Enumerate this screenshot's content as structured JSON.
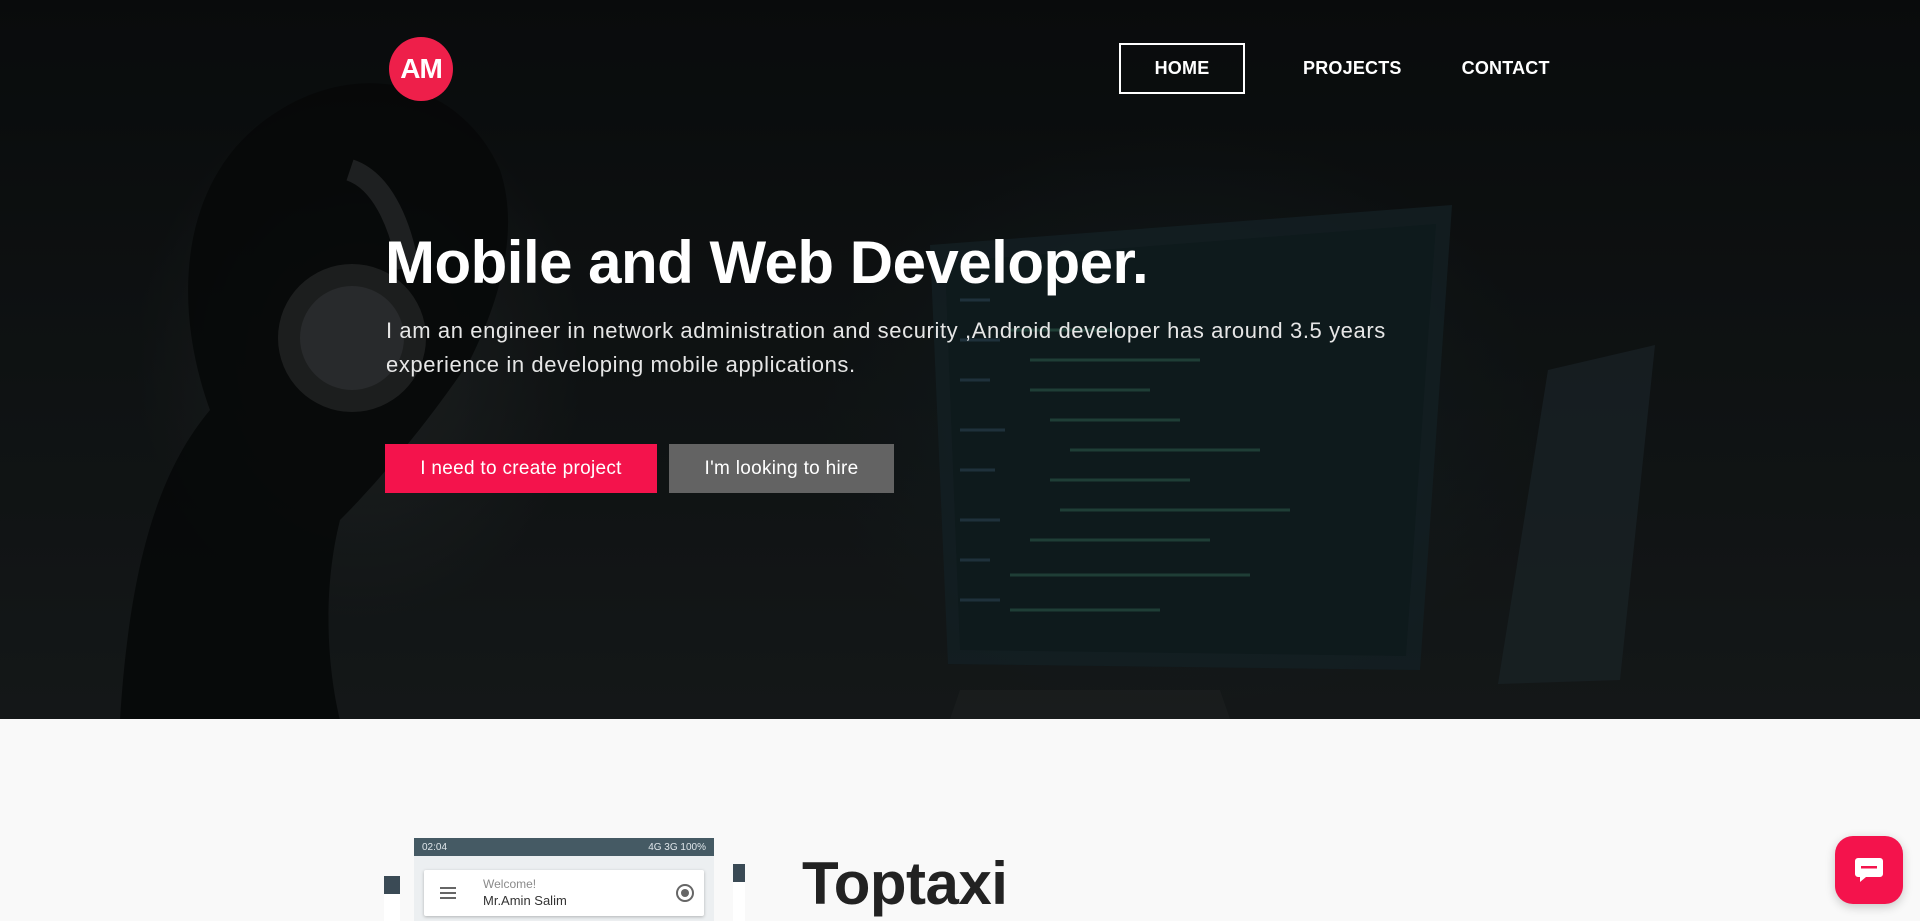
{
  "brand": {
    "logo_text": "AM"
  },
  "nav": {
    "items": [
      {
        "label": "HOME",
        "active": true
      },
      {
        "label": "PROJECTS"
      },
      {
        "label": "CONTACT"
      }
    ]
  },
  "hero": {
    "title": "Mobile and Web Developer.",
    "description": "I am an engineer in network administration and security ,Android developer has around 3.5 years experience in developing mobile applications.",
    "primary_button": "I need to create project",
    "secondary_button": "I'm looking to hire"
  },
  "project": {
    "title": "Toptaxi",
    "phone": {
      "status_time": "02:04",
      "status_right": "4G 3G 100%",
      "welcome": "Welcome!",
      "user_name": "Mr.Amin Salim"
    }
  },
  "chat": {
    "icon": "chat-bubble-icon"
  },
  "colors": {
    "accent": "#f4134c",
    "logo": "#ee1f4a",
    "secondary_button": "#636363"
  }
}
